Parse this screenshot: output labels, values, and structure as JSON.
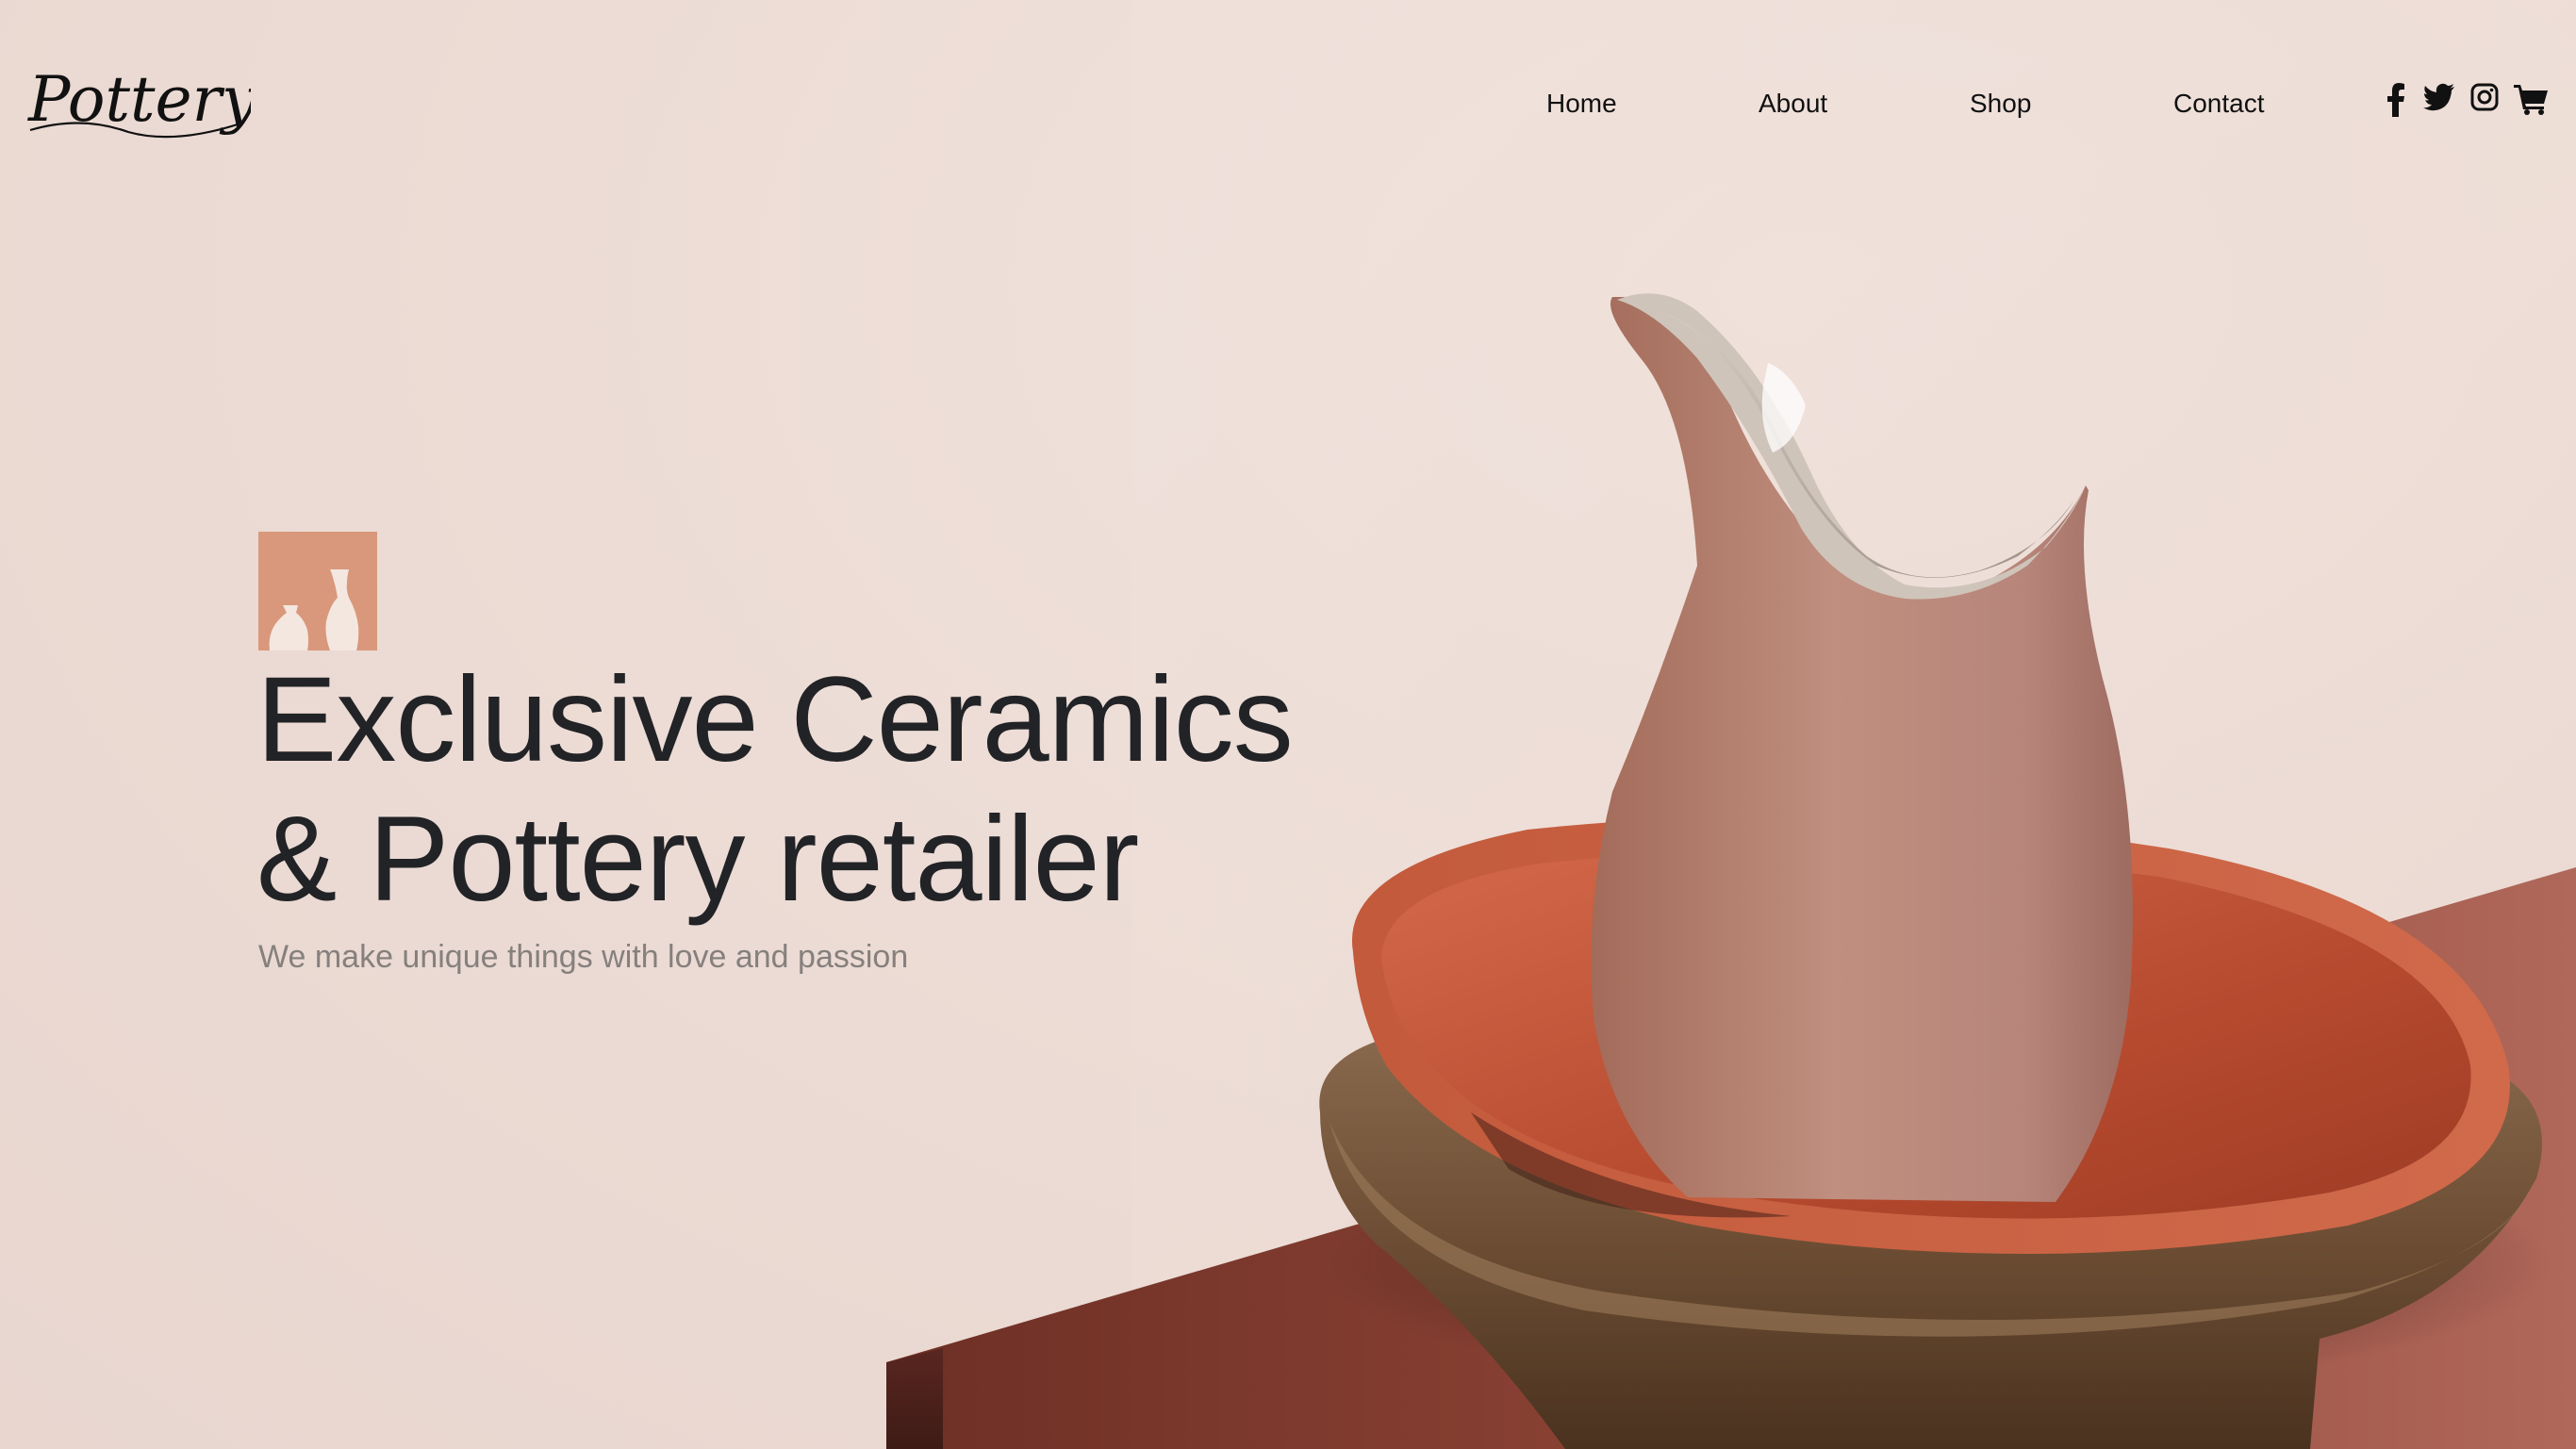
{
  "header": {
    "logo_text": "Pottery",
    "nav": [
      {
        "label": "Home"
      },
      {
        "label": "About"
      },
      {
        "label": "Shop"
      },
      {
        "label": "Contact"
      }
    ],
    "social_icons": [
      "facebook-icon",
      "twitter-icon",
      "instagram-icon",
      "cart-icon"
    ]
  },
  "hero": {
    "title_line1": "Exclusive Ceramics",
    "title_line2": "& Pottery retailer",
    "subtitle": "We make unique things with love and passion",
    "badge_icon": "vases-icon"
  },
  "colors": {
    "background": "#eeded8",
    "accent": "#d9987c",
    "title": "#222326",
    "subtitle": "#86807d",
    "pitcher": "#b07a68",
    "bowl": "#c0553a",
    "table": "#9c4f3f"
  }
}
